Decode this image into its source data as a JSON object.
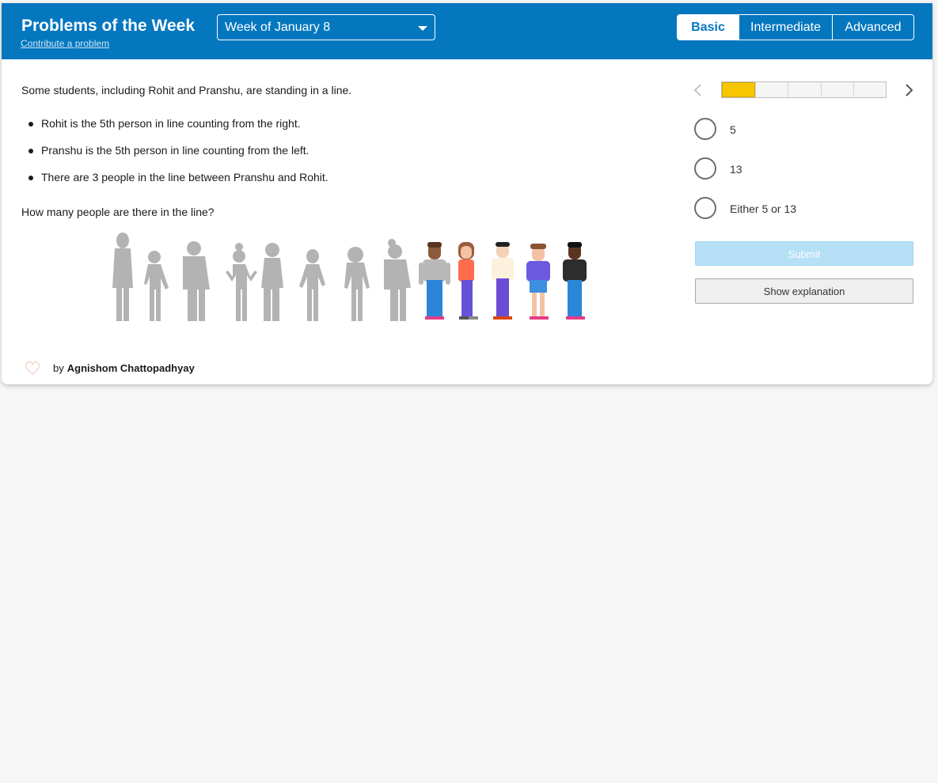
{
  "header": {
    "title": "Problems of the Week",
    "contribute_link": "Contribute a problem",
    "week_select": {
      "selected": "Week of January 8"
    },
    "levels": [
      {
        "label": "Basic",
        "active": true
      },
      {
        "label": "Intermediate",
        "active": false
      },
      {
        "label": "Advanced",
        "active": false
      }
    ]
  },
  "problem": {
    "intro": "Some students, including Rohit and Pranshu, are standing in a line.",
    "facts": [
      "Rohit is the 5th person in line counting from the right.",
      "Pranshu is the 5th person in line counting from the left.",
      "There are 3 people in the line between Pranshu and Rohit."
    ],
    "question": "How many people are there in the line?"
  },
  "author": {
    "by_label": "by",
    "name": "Agnishom Chattopadhyay"
  },
  "progress": {
    "current": 1,
    "total": 5
  },
  "options": [
    "5",
    "13",
    "Either 5 or 13"
  ],
  "buttons": {
    "submit": "Submit",
    "explanation": "Show explanation"
  },
  "colors": {
    "header_bg": "#0477bf",
    "progress_fill": "#f7c600",
    "submit_disabled": "#b5e0f6",
    "silhouette": "#b3b3b3"
  },
  "icons": {
    "prev": "chevron-left-icon",
    "next": "chevron-right-icon",
    "dropdown": "caret-down-icon"
  }
}
